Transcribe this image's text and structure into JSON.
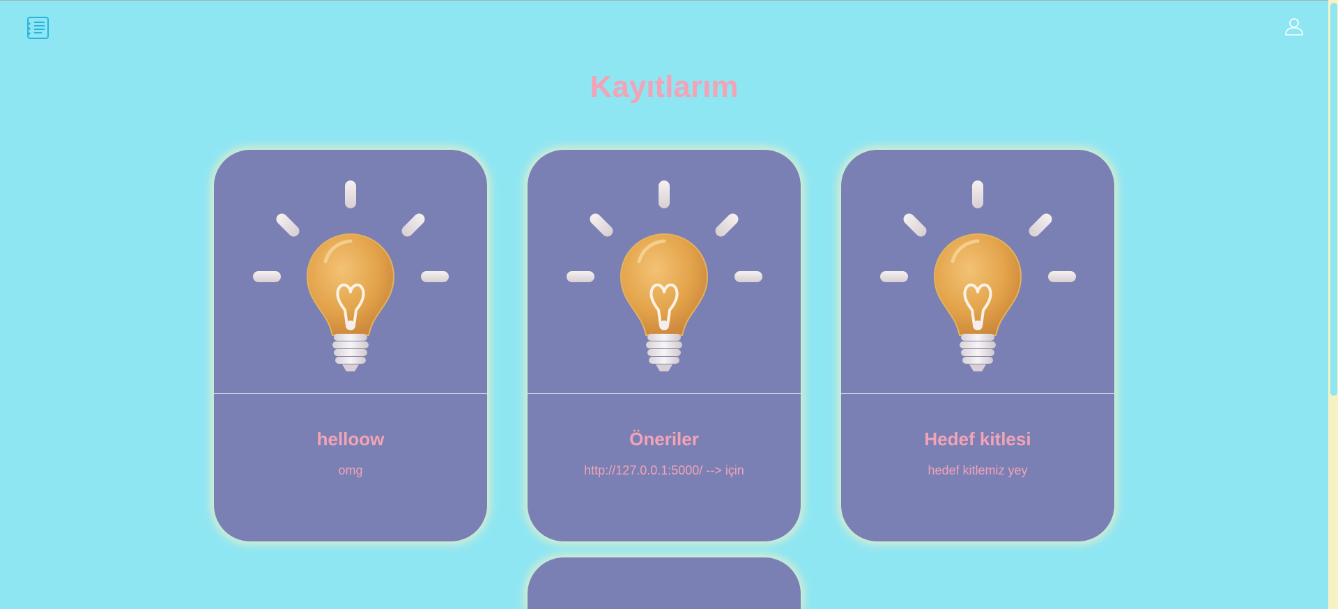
{
  "header": {
    "menu_icon": "notes-list-icon",
    "user_icon": "user-icon"
  },
  "page": {
    "title": "Kayıtlarım"
  },
  "colors": {
    "background": "#8fe6f3",
    "card": "#7a80b4",
    "accent_text": "#f3a3b6",
    "card_glow": "#faf0be"
  },
  "cards": [
    {
      "title": "helloow",
      "description": "omg",
      "image": "lightbulb-icon"
    },
    {
      "title": "Öneriler",
      "description": "http://127.0.0.1:5000/ --> için",
      "image": "lightbulb-icon"
    },
    {
      "title": "Hedef kitlesi",
      "description": "hedef kitlemiz yey",
      "image": "lightbulb-icon"
    },
    {
      "title": "",
      "description": "",
      "image": ""
    }
  ]
}
